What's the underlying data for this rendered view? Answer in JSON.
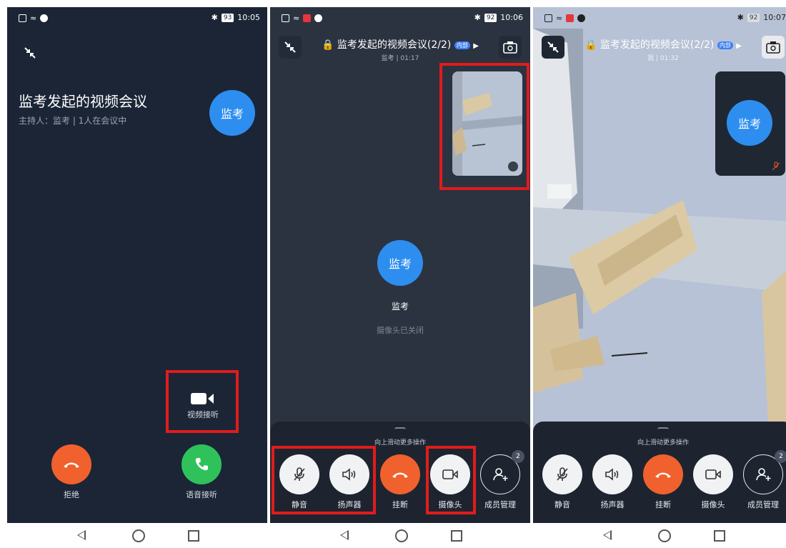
{
  "colors": {
    "accent_blue": "#2e8ef0",
    "end_call": "#f0612d",
    "accept_call": "#2fc25b",
    "highlight_red": "#e01c1c"
  },
  "panel1": {
    "status": {
      "time": "10:05",
      "battery": "93"
    },
    "meeting_title": "监考发起的视频会议",
    "host_info": "主持人：监考 | 1人在会议中",
    "avatar_text": "监考",
    "video_answer_label": "视频接听",
    "reject_label": "拒绝",
    "voice_answer_label": "语音接听"
  },
  "panel2": {
    "status": {
      "time": "10:06",
      "battery": "92"
    },
    "title": "监考发起的视频会议(2/2)",
    "tag": "内部",
    "subtitle": "监考 | 01:17",
    "avatar_text": "监考",
    "participant_name": "监考",
    "camera_status": "摄像头已关闭",
    "sheet_hint": "向上滑动更多操作",
    "controls": [
      "静音",
      "扬声器",
      "挂断",
      "摄像头",
      "成员管理"
    ],
    "member_badge": "2"
  },
  "panel3": {
    "status": {
      "time": "10:07",
      "battery": "92"
    },
    "title": "监考发起的视频会议(2/2)",
    "tag": "内部",
    "subtitle": "我 | 01:32",
    "avatar_text": "监考",
    "sheet_hint": "向上滑动更多操作",
    "controls": [
      "静音",
      "扬声器",
      "挂断",
      "摄像头",
      "成员管理"
    ],
    "member_badge": "2"
  }
}
